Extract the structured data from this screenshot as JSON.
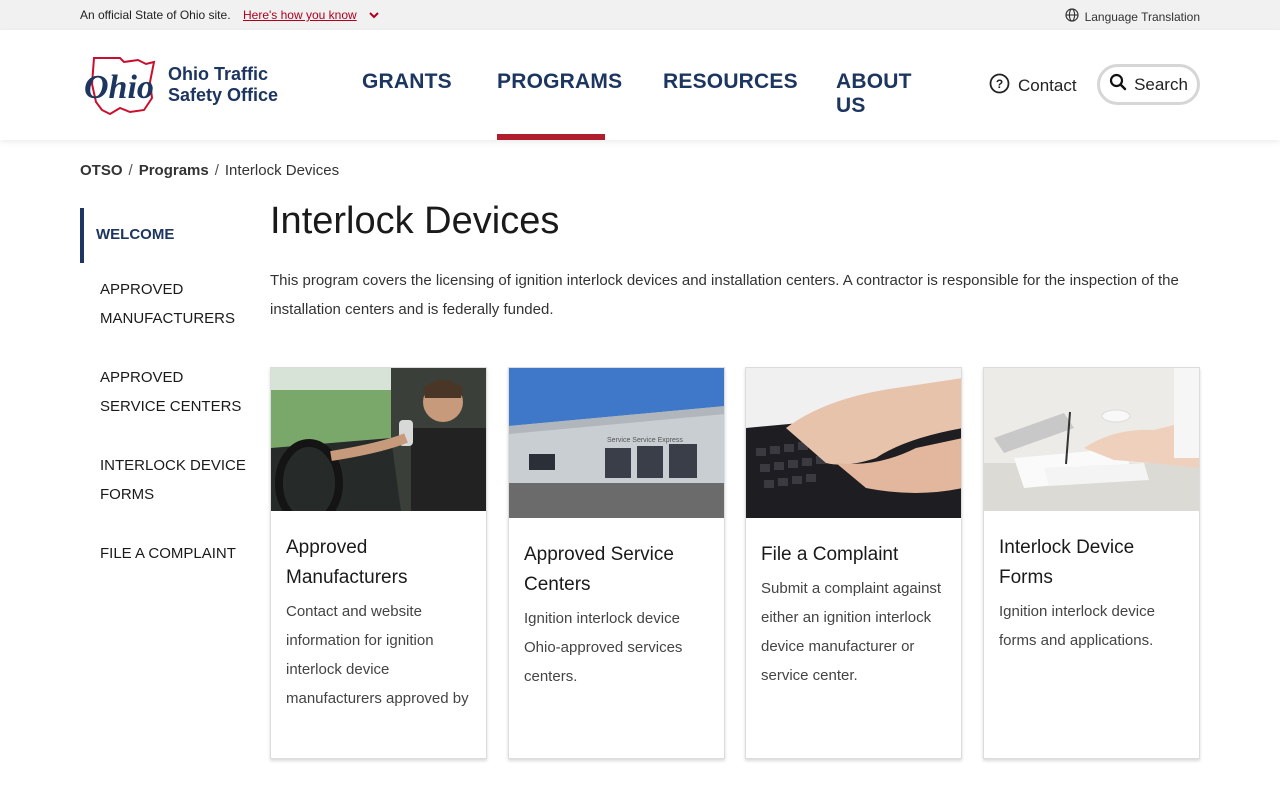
{
  "banner": {
    "official_text": "An official State of Ohio site.",
    "how_link": "Here's how you know",
    "language": "Language Translation"
  },
  "header": {
    "logo_word": "Ohio",
    "org_line1": "Ohio Traffic",
    "org_line2": "Safety Office",
    "nav": [
      "GRANTS",
      "PROGRAMS",
      "RESOURCES",
      "ABOUT US"
    ],
    "active_nav": "PROGRAMS",
    "contact_label": "Contact",
    "search_label": "Search"
  },
  "breadcrumb": {
    "root": "OTSO",
    "sep": "/",
    "section": "Programs",
    "current": "Interlock Devices"
  },
  "sidebar": {
    "items": [
      {
        "label": "WELCOME",
        "active": true
      },
      {
        "label": "APPROVED MANUFACTURERS"
      },
      {
        "label": "APPROVED SERVICE CENTERS"
      },
      {
        "label": "INTERLOCK DEVICE FORMS"
      },
      {
        "label": "FILE A COMPLAINT"
      }
    ]
  },
  "main": {
    "title": "Interlock Devices",
    "intro": "This program covers the licensing of ignition interlock devices and installation centers. A contractor is responsible for the inspection of the installation centers and is federally funded.",
    "cards": [
      {
        "title": "Approved Manufacturers",
        "desc": "Contact and website information for ignition interlock device manufacturers approved by",
        "image": "driver-using-interlock-device"
      },
      {
        "title": "Approved Service Centers",
        "desc": "Ignition interlock device Ohio-approved services centers.",
        "image": "service-center-building"
      },
      {
        "title": "File a Complaint",
        "desc": "Submit a complaint against either an ignition interlock device manufacturer or service center.",
        "image": "hands-typing-keyboard"
      },
      {
        "title": "Interlock Device Forms",
        "desc": "Ignition interlock device forms and applications.",
        "image": "hand-writing-form"
      }
    ]
  },
  "colors": {
    "brand_navy": "#1d3660",
    "accent_red": "#b01e2e",
    "link_red": "#b00020"
  }
}
